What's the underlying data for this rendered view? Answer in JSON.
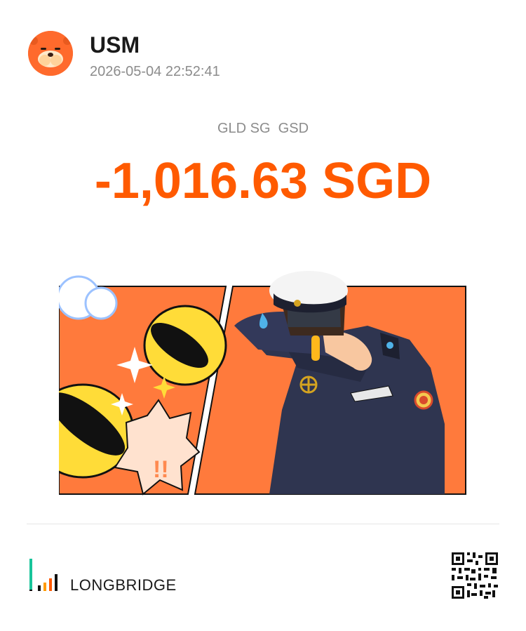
{
  "header": {
    "username": "USM",
    "timestamp": "2026-05-04 22:52:41",
    "avatar_icon": "mascot-avatar-icon"
  },
  "position": {
    "symbol": "GLD SG  GSD",
    "pnl": "-1,016.63 SGD",
    "pnl_color": "#ff5a00"
  },
  "illustration": {
    "icon": "loss-captain-illustration",
    "background_color": "#ff7a3c"
  },
  "footer": {
    "brand_name": "LONGBRIDGE",
    "logo_icon": "longbridge-logo-icon",
    "qr_icon": "qr-code-icon"
  }
}
